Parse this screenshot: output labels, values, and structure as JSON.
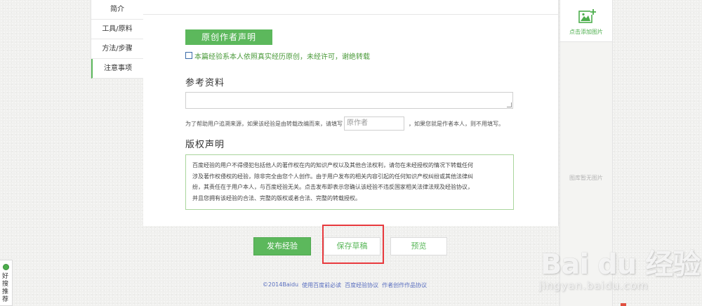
{
  "side_nav": {
    "items": [
      {
        "label": "简介",
        "active": false
      },
      {
        "label": "工具/原料",
        "active": false
      },
      {
        "label": "方法/步骤",
        "active": false
      },
      {
        "label": "注意事项",
        "active": true
      }
    ]
  },
  "original": {
    "badge": "原创作者声明",
    "checkbox_checked": false,
    "statement": "本篇经验系本人依照真实经历原创，未经许可，谢绝转载"
  },
  "reference": {
    "title": "参考资料",
    "textarea_value": "",
    "help_prefix": "为了帮助用户追溯来源，如果该经验是由转载改编而来，请填写",
    "author_placeholder": "原作者",
    "help_suffix": "，如果您就是作者本人，则不用填写。"
  },
  "copyright": {
    "title": "版权声明",
    "lines": [
      "百度经验的用户不得侵犯包括他人的著作权在内的知识产权以及其他合法权利，请勿在未经授权的情况下转载任何",
      "涉及著作权侵权的经验，除非完全由您个人创作。由于用户发布的相关内容引起的任何知识产权纠纷或其他法律纠",
      "纷，其责任在于用户本人，与百度经验无关。点击发布即表示您确认该经验不违反国家相关法律法规及经验协议，",
      "并且您拥有该经验的合法、完整的版权或者合法、完整的转载授权。"
    ]
  },
  "actions": {
    "publish": "发布经验",
    "save_draft": "保存草稿",
    "preview": "预览"
  },
  "footer": {
    "copyright": "©2014Baidu",
    "links": [
      "使用百度前必读",
      "百度经验协议",
      "作者创作作品协议"
    ]
  },
  "image_panel": {
    "add_label": "点击添加图片",
    "empty_label": "图库暂无图片"
  },
  "watermark": {
    "logo": "Bai du 经验",
    "url": "jingyan.baidu.com"
  },
  "recommend_widget": {
    "label": "好搜推荐"
  },
  "colors": {
    "accent_green": "#5cb85c",
    "highlight_red": "#e8393d",
    "link_blue": "#5a6fc0"
  }
}
